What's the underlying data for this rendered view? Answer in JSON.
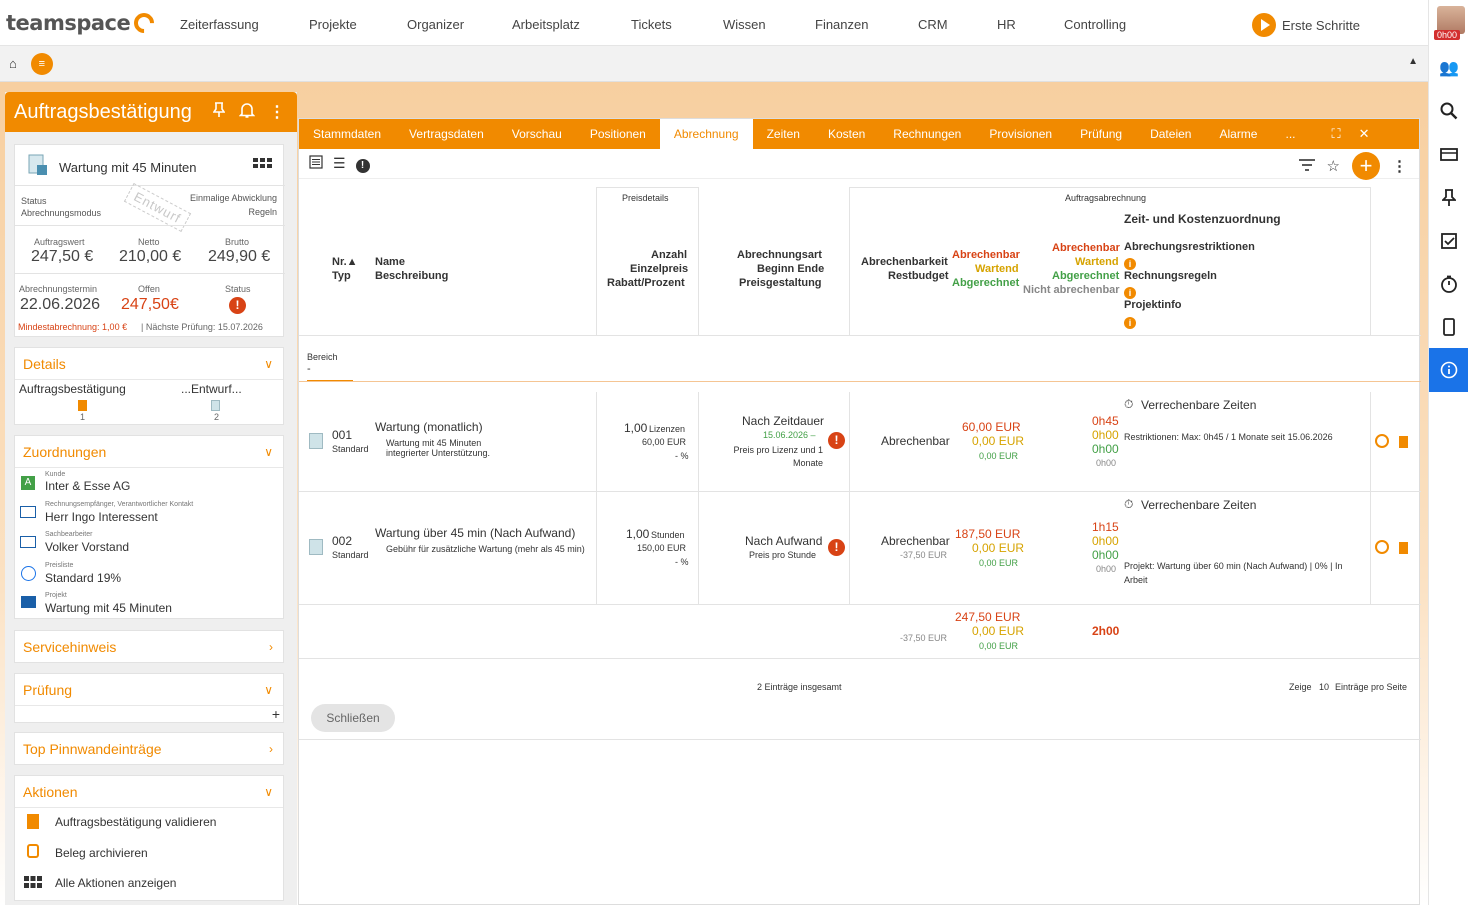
{
  "app": {
    "logo": "teamspace"
  },
  "topnav": [
    "Zeiterfassung",
    "Projekte",
    "Organizer",
    "Arbeitsplatz",
    "Tickets",
    "Wissen",
    "Finanzen",
    "CRM",
    "HR",
    "Controlling"
  ],
  "topright": {
    "first_steps": "Erste Schritte",
    "timer": "0h00"
  },
  "left": {
    "title": "Auftragsbestätigung",
    "doc_name": "Wartung mit 45 Minuten",
    "status_label": "Status",
    "status_value": "Einmalige Abwicklung",
    "mode_label": "Abrechnungsmodus",
    "mode_value": "Regeln",
    "stamp": "Entwurf",
    "auftragswert_label": "Auftragswert",
    "auftragswert": "247,50 €",
    "netto_label": "Netto",
    "netto": "210,00 €",
    "brutto_label": "Brutto",
    "brutto": "249,90 €",
    "termin_label": "Abrechnungstermin",
    "termin": "22.06.2026",
    "offen_label": "Offen",
    "offen": "247,50€",
    "status2_label": "Status",
    "mindest": "Mindestabrechnung: 1,00 €",
    "naechste": "| Nächste Prüfung: 15.07.2026",
    "details_title": "Details",
    "details_left": "Auftragsbestätigung",
    "details_right": "...Entwurf...",
    "details_count1": "1",
    "details_count2": "2",
    "zuordnungen_title": "Zuordnungen",
    "z": [
      {
        "label": "Kunde",
        "value": "Inter & Esse AG"
      },
      {
        "label": "Rechnungsempfänger, Verantwortlicher Kontakt",
        "value": "Herr Ingo Interessent"
      },
      {
        "label": "Sachbearbeiter",
        "value": "Volker Vorstand"
      },
      {
        "label": "Preisliste",
        "value": "Standard 19%"
      },
      {
        "label": "Projekt",
        "value": "Wartung mit 45 Minuten"
      }
    ],
    "servicehinweis": "Servicehinweis",
    "pruefung": "Prüfung",
    "pinnwand": "Top Pinnwandeinträge",
    "aktionen": "Aktionen",
    "aktionen_items": [
      "Auftragsbestätigung validieren",
      "Beleg archivieren",
      "Alle Aktionen anzeigen"
    ]
  },
  "tabs": [
    "Stammdaten",
    "Vertragsdaten",
    "Vorschau",
    "Positionen",
    "Abrechnung",
    "Zeiten",
    "Kosten",
    "Rechnungen",
    "Provisionen",
    "Prüfung",
    "Dateien",
    "Alarme",
    "..."
  ],
  "header": {
    "preisdetails": "Preisdetails",
    "auftragsabrechnung": "Auftragsabrechnung",
    "zeit_kosten": "Zeit- und Kostenzuordnung",
    "nr": "Nr.▲",
    "typ": "Typ",
    "name": "Name",
    "beschreibung": "Beschreibung",
    "anzahl": "Anzahl",
    "einzelpreis": "Einzelpreis",
    "rabatt": "Rabatt/Prozent",
    "abrechnungsart": "Abrechnungsart",
    "beginn_ende": "Beginn Ende",
    "preisgestaltung": "Preisgestaltung",
    "abrechenbarkeit": "Abrechenbarkeit",
    "restbudget": "Restbudget",
    "abrechenbar": "Abrechenbar",
    "wartend": "Wartend",
    "abgerechnet": "Abgerechnet",
    "nicht_abrechenbar": "Nicht abrechenbar",
    "restriktionen": "Abrechungsrestriktionen",
    "regeln": "Rechnungsregeln",
    "projektinfo": "Projektinfo",
    "bereich_label": "Bereich",
    "bereich_value": "-"
  },
  "rows": [
    {
      "nr": "001",
      "typ": "Standard",
      "name": "Wartung (monatlich)",
      "desc": "Wartung mit 45 Minuten integrierter Unterstützung.",
      "anzahl": "1,00",
      "einheit": "Lizenzen",
      "preis": "60,00 EUR",
      "rabatt": "- %",
      "art": "Nach Zeitdauer",
      "datum": "15.06.2026 –",
      "preis_info": "Preis pro Lizenz und 1 Monate",
      "abrechenbarkeit": "Abrechenbar",
      "restbudget": "",
      "eur_rot": "60,00 EUR",
      "eur_gelb": "0,00 EUR",
      "eur_gruen": "0,00 EUR",
      "t_rot": "0h45",
      "t_gelb": "0h00",
      "t_gruen": "0h00",
      "t_grau": "0h00",
      "zeiten": "Verrechenbare Zeiten",
      "info": "Restriktionen: Max: 0h45 / 1 Monate seit 15.06.2026"
    },
    {
      "nr": "002",
      "typ": "Standard",
      "name": "Wartung über 45 min (Nach Aufwand)",
      "desc": "Gebühr für zusätzliche Wartung (mehr als 45 min)",
      "anzahl": "1,00",
      "einheit": "Stunden",
      "preis": "150,00 EUR",
      "rabatt": "- %",
      "art": "Nach Aufwand",
      "datum": "",
      "preis_info": "Preis pro Stunde",
      "abrechenbarkeit": "Abrechenbar",
      "restbudget": "-37,50 EUR",
      "eur_rot": "187,50 EUR",
      "eur_gelb": "0,00 EUR",
      "eur_gruen": "0,00 EUR",
      "t_rot": "1h15",
      "t_gelb": "0h00",
      "t_gruen": "0h00",
      "t_grau": "0h00",
      "zeiten": "Verrechenbare Zeiten",
      "info": "Projekt: Wartung über 60 min (Nach Aufwand) | 0% | In Arbeit"
    }
  ],
  "totals": {
    "restbudget": "-37,50 EUR",
    "rot": "247,50 EUR",
    "gelb": "0,00 EUR",
    "gruen": "0,00 EUR",
    "zeit": "2h00"
  },
  "footer": {
    "count": "2 Einträge insgesamt",
    "zeige": "Zeige",
    "per_page": "10",
    "per_page_label": "Einträge pro Seite",
    "close": "Schließen"
  }
}
